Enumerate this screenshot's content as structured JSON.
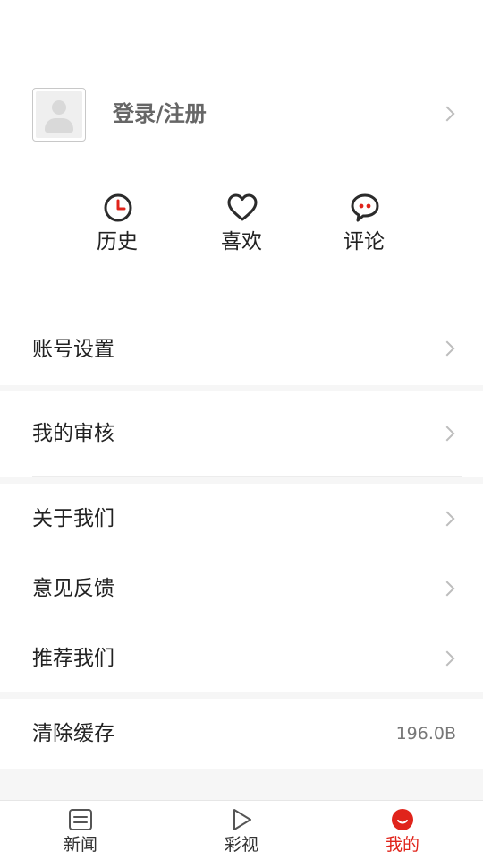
{
  "profile": {
    "login_label": "登录/注册"
  },
  "quick_actions": [
    {
      "icon": "clock-icon",
      "label": "历史"
    },
    {
      "icon": "heart-icon",
      "label": "喜欢"
    },
    {
      "icon": "comment-icon",
      "label": "评论"
    }
  ],
  "menu": {
    "account_settings": "账号设置",
    "my_review": "我的审核",
    "about_us": "关于我们",
    "feedback": "意见反馈",
    "recommend_us": "推荐我们",
    "clear_cache": "清除缓存",
    "cache_size": "196.0B"
  },
  "tabbar": {
    "items": [
      {
        "icon": "news-icon",
        "label": "新闻"
      },
      {
        "icon": "play-icon",
        "label": "彩视"
      },
      {
        "icon": "smile-icon",
        "label": "我的",
        "active": true
      }
    ]
  },
  "colors": {
    "accent": "#e0241b",
    "icon_dark": "#2b2b2b",
    "muted_text": "#666666",
    "chevron": "#bdbdbd",
    "page_bg": "#f6f6f6"
  }
}
